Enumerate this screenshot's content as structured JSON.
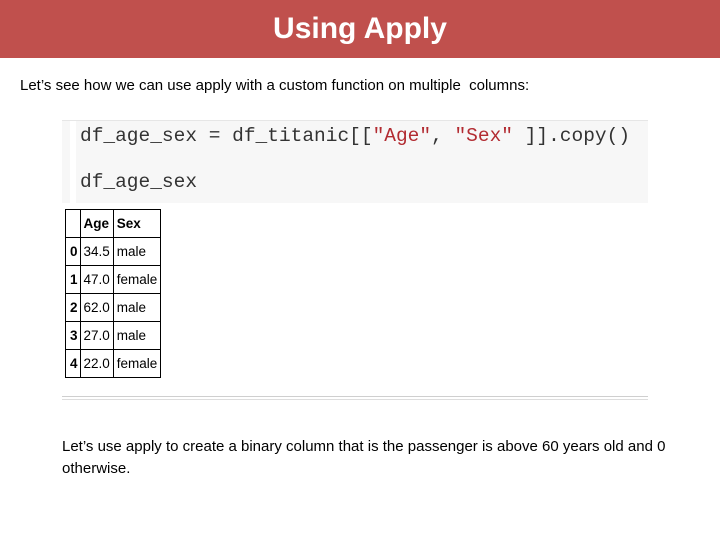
{
  "slide": {
    "title": "Using Apply",
    "intro_text": "Let’s see how we can use apply with a custom function on multiple  columns:",
    "outro_text": "Let’s use apply to create a binary column that is the passenger is above 60 years old and 0 otherwise."
  },
  "code": {
    "line1_var": "df_age_sex",
    "line1_mid": " = df_titanic[[",
    "line1_str1": "\"Age\"",
    "line1_comma": ", ",
    "line1_str2": "\"Sex\"",
    "line1_end": " ]].copy()",
    "line2": "df_age_sex"
  },
  "table": {
    "columns": [
      "",
      "Age",
      "Sex"
    ],
    "rows": [
      {
        "index": "0",
        "age": "34.5",
        "sex": "male"
      },
      {
        "index": "1",
        "age": "47.0",
        "sex": "female"
      },
      {
        "index": "2",
        "age": "62.0",
        "sex": "male"
      },
      {
        "index": "3",
        "age": "27.0",
        "sex": "male"
      },
      {
        "index": "4",
        "age": "22.0",
        "sex": "female"
      }
    ]
  },
  "colors": {
    "title_bar": "#c0504d",
    "string_literal": "#b22b31"
  }
}
